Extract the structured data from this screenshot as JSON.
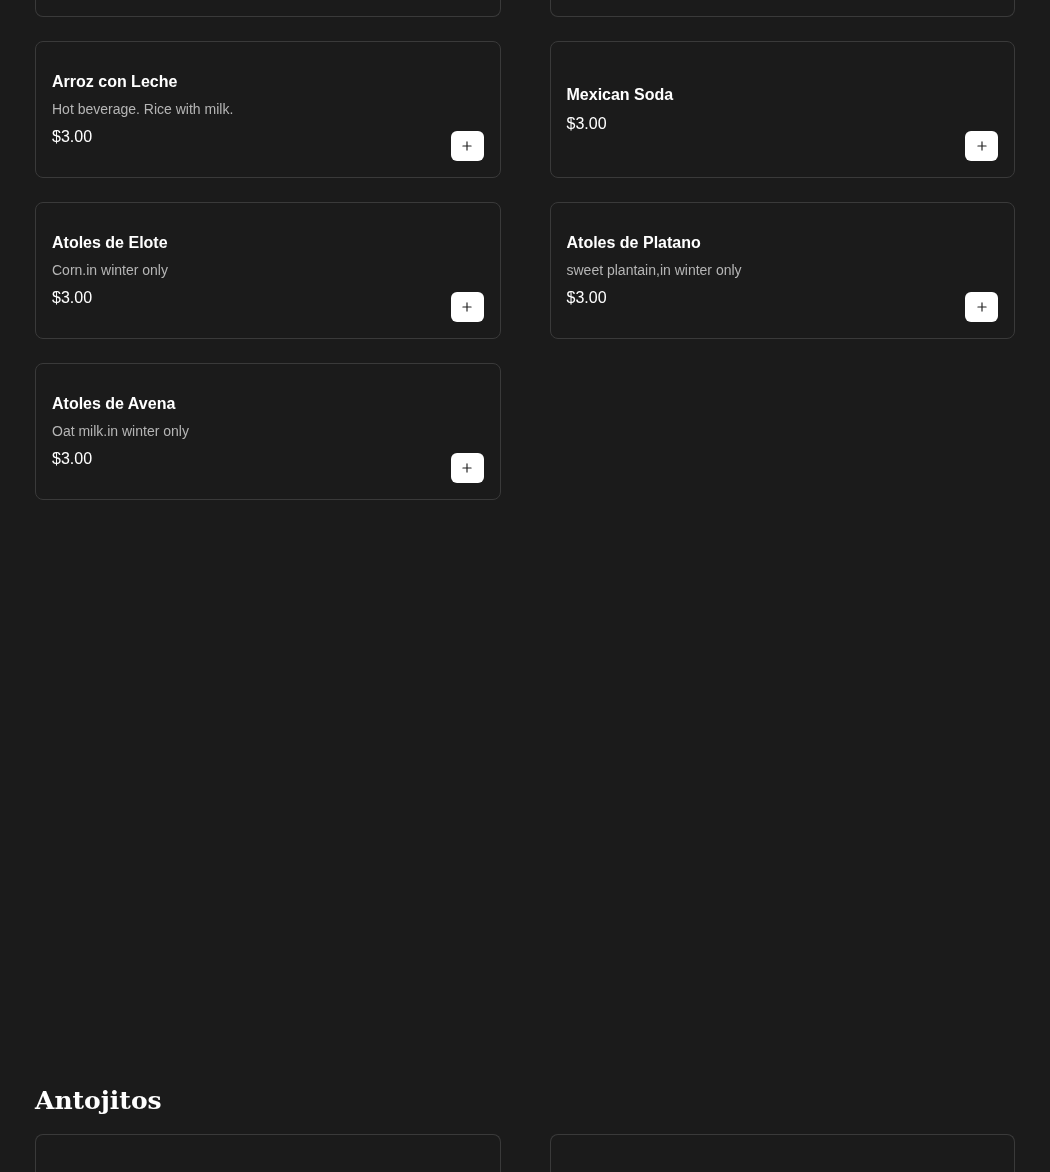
{
  "items": [
    {
      "name": "Arroz con Leche",
      "description": "Hot beverage. Rice with milk.",
      "price": "$3.00"
    },
    {
      "name": "Mexican Soda",
      "price": "$3.00"
    },
    {
      "name": "Atoles de Elote",
      "description": "Corn.in winter only",
      "price": "$3.00"
    },
    {
      "name": "Atoles de Platano",
      "description": "sweet plantain,in winter only",
      "price": "$3.00"
    },
    {
      "name": "Atoles de Avena",
      "description": "Oat milk.in winter only",
      "price": "$3.00"
    }
  ],
  "next_section": {
    "title": "Antojitos"
  }
}
